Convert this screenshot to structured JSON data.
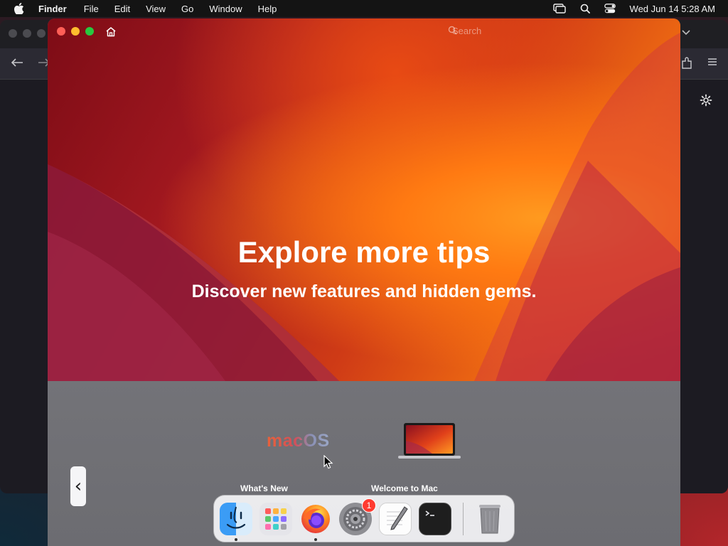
{
  "menubar": {
    "app_name": "Finder",
    "items": [
      "File",
      "Edit",
      "View",
      "Go",
      "Window",
      "Help"
    ],
    "clock": "Wed Jun 14  5:28 AM",
    "status_icons": [
      "screen-mirroring-icon",
      "spotlight-search-icon",
      "control-center-icon"
    ]
  },
  "tips_window": {
    "search_placeholder": "Search",
    "hero_title": "Explore more tips",
    "hero_subtitle": "Discover new features and hidden gems.",
    "logo_text": "macOS",
    "cards": [
      {
        "label": "What's New"
      },
      {
        "label": "Welcome to Mac"
      }
    ],
    "prev_glyph": "‹"
  },
  "dock": {
    "apps": [
      {
        "name": "Finder",
        "icon": "finder-icon",
        "running": true
      },
      {
        "name": "Launchpad",
        "icon": "launchpad-icon",
        "running": false
      },
      {
        "name": "Firefox",
        "icon": "firefox-icon",
        "running": true
      },
      {
        "name": "System Settings",
        "icon": "system-settings-icon",
        "running": false,
        "badge": "1"
      },
      {
        "name": "TextEdit",
        "icon": "textedit-icon",
        "running": false
      },
      {
        "name": "Terminal",
        "icon": "terminal-icon",
        "running": false
      },
      {
        "name": "Trash",
        "icon": "trash-icon",
        "running": false
      }
    ]
  },
  "colors": {
    "close": "#ff5f57",
    "minimize": "#febc2e",
    "maximize": "#28c840",
    "badge": "#ff3b30"
  }
}
